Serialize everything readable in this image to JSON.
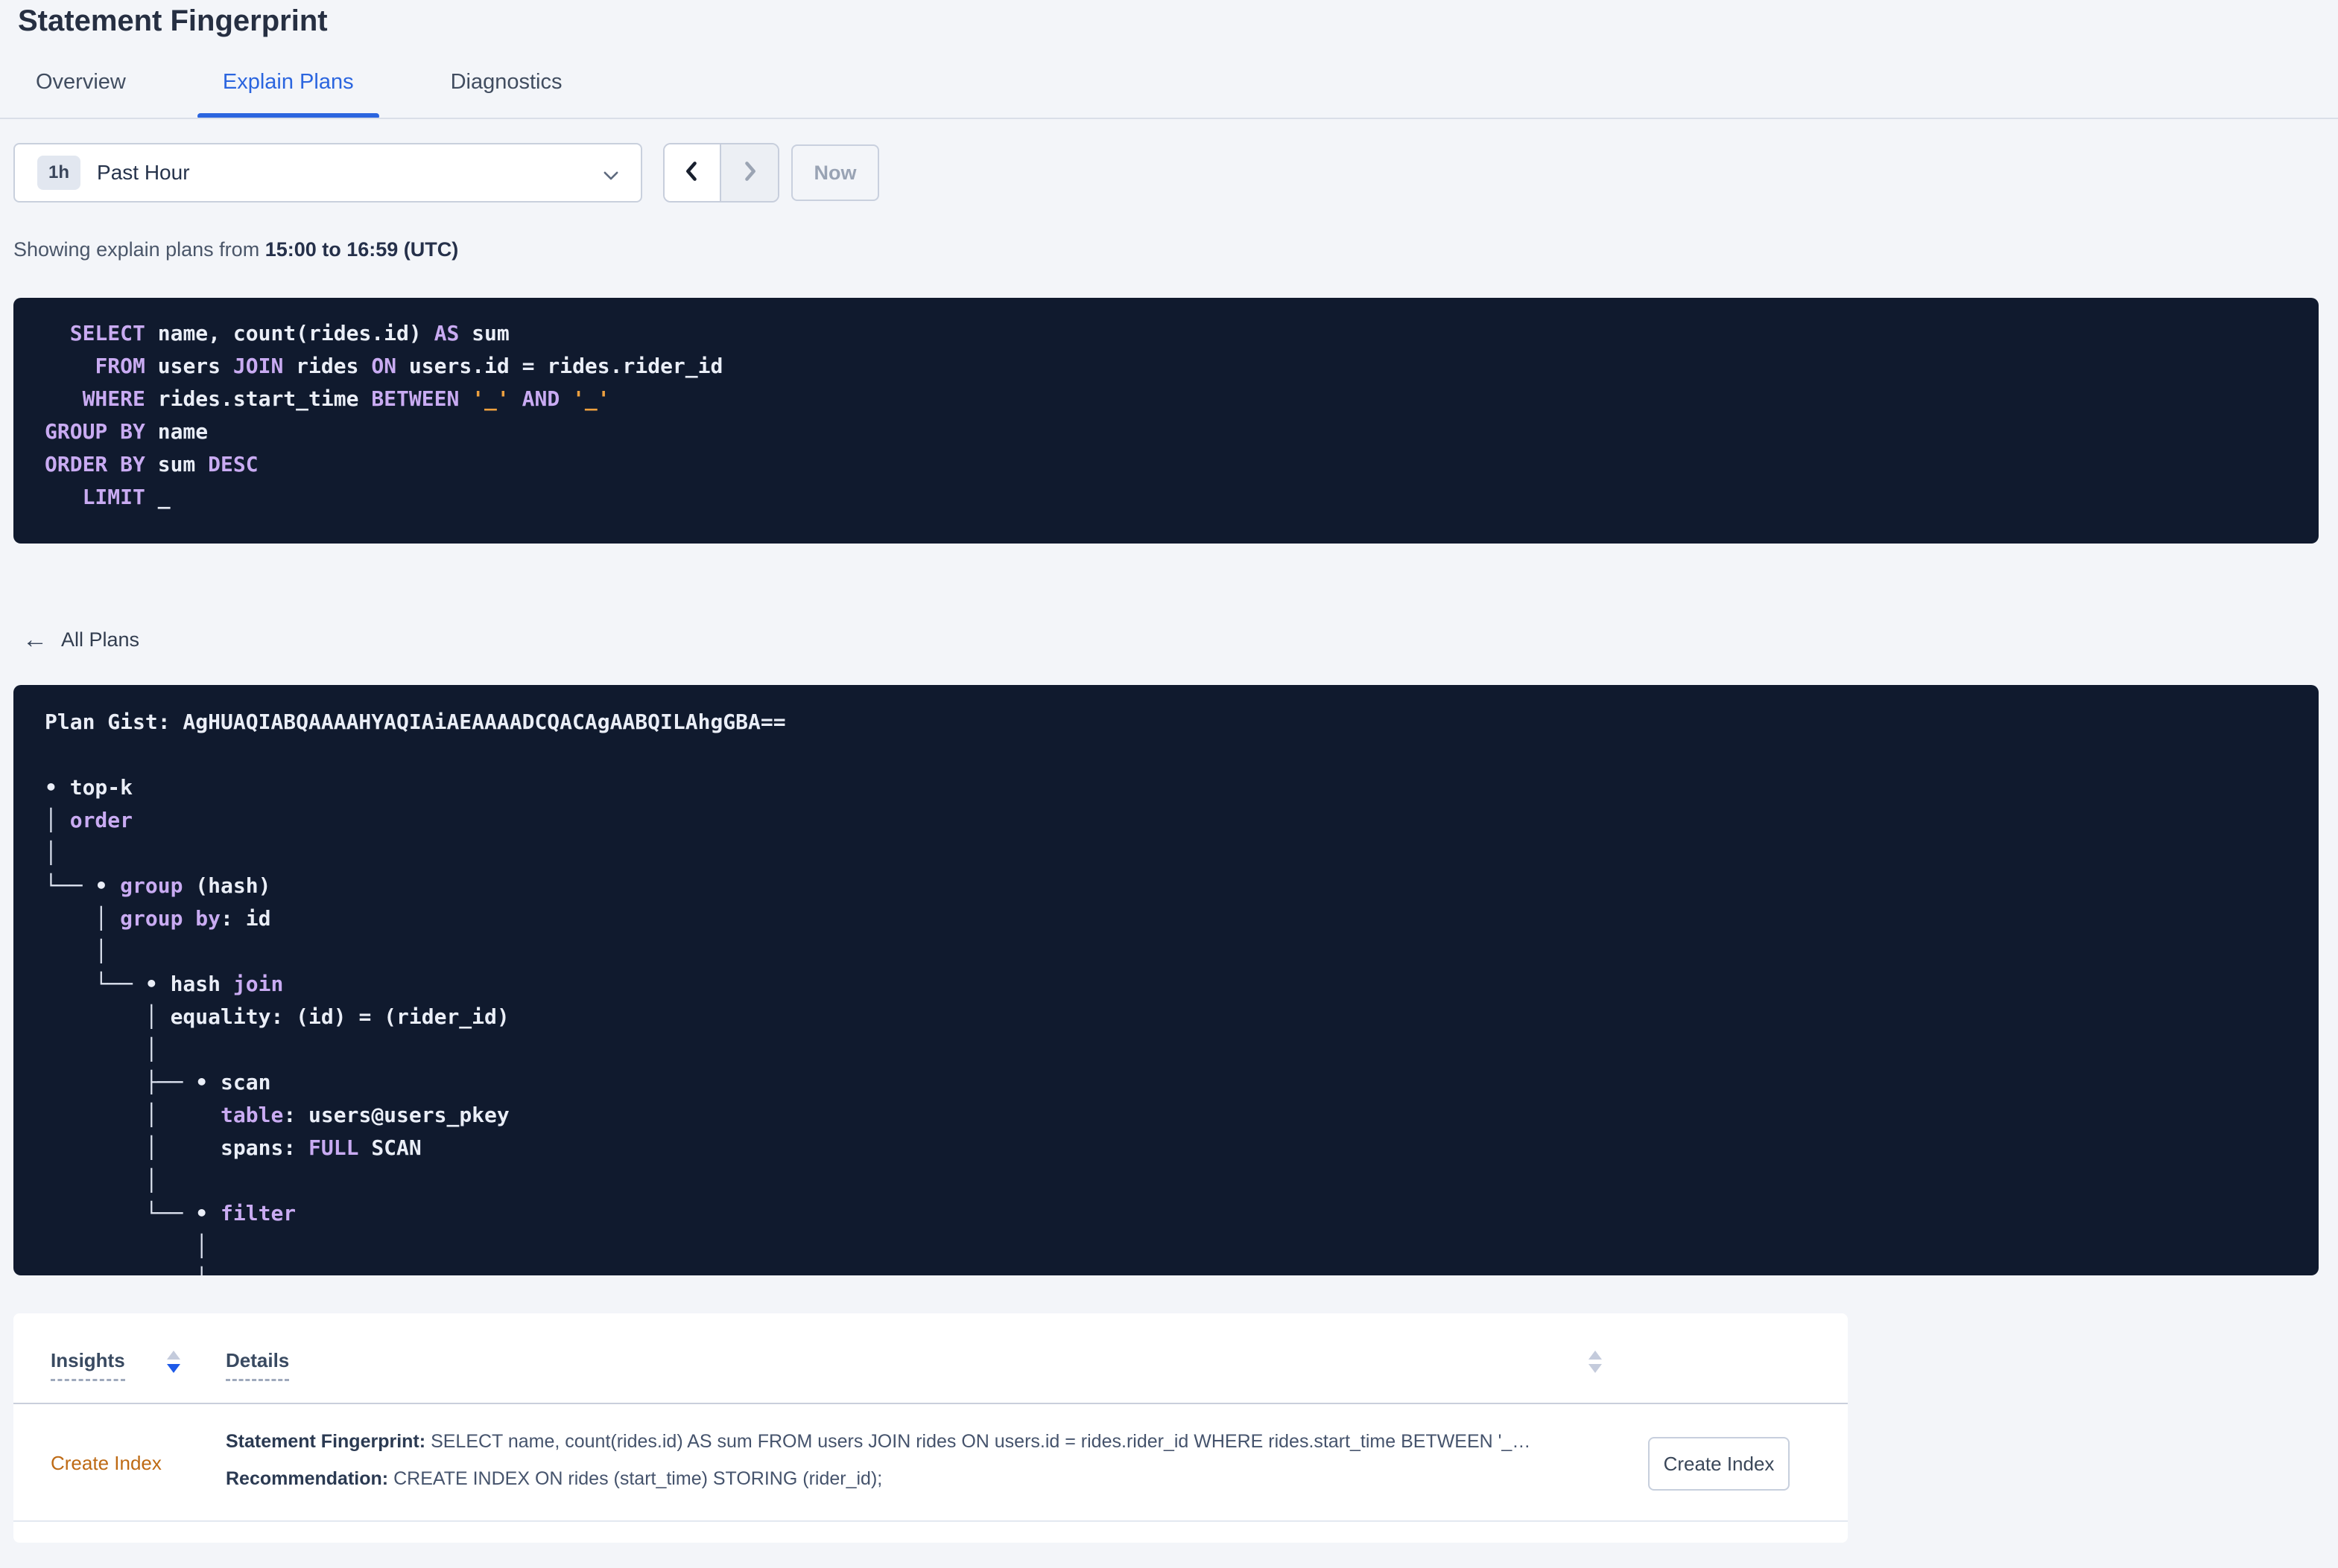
{
  "page_title": "Statement Fingerprint",
  "tabs": [
    {
      "label": "Overview",
      "active": false
    },
    {
      "label": "Explain Plans",
      "active": true
    },
    {
      "label": "Diagnostics",
      "active": false
    }
  ],
  "time_picker": {
    "badge": "1h",
    "selected": "Past Hour",
    "icon": "chevron-down"
  },
  "nav": {
    "back_icon": "chevron-left",
    "forward_icon": "chevron-right",
    "now_label": "Now"
  },
  "showing": {
    "prefix": "Showing explain plans from ",
    "range": "15:00 to 16:59 (UTC)"
  },
  "colors": {
    "accent_blue": "#2B65DF",
    "keyword_purple": "#C9ABF2",
    "placeholder_orange": "#EDA03F",
    "insight_orange": "#BE6A14",
    "code_background": "#101A2E"
  },
  "sql": {
    "lines": [
      [
        {
          "t": "  ",
          "c": "p"
        },
        {
          "t": "SELECT",
          "c": "k"
        },
        {
          "t": " name, count(rides.id) ",
          "c": "p"
        },
        {
          "t": "AS",
          "c": "k"
        },
        {
          "t": " sum",
          "c": "p"
        }
      ],
      [
        {
          "t": "    ",
          "c": "p"
        },
        {
          "t": "FROM",
          "c": "k"
        },
        {
          "t": " users ",
          "c": "p"
        },
        {
          "t": "JOIN",
          "c": "k"
        },
        {
          "t": " rides ",
          "c": "p"
        },
        {
          "t": "ON",
          "c": "k"
        },
        {
          "t": " users.id = rides.rider_id",
          "c": "p"
        }
      ],
      [
        {
          "t": "   ",
          "c": "p"
        },
        {
          "t": "WHERE",
          "c": "k"
        },
        {
          "t": " rides.start_time ",
          "c": "p"
        },
        {
          "t": "BETWEEN",
          "c": "k"
        },
        {
          "t": " ",
          "c": "p"
        },
        {
          "t": "'_'",
          "c": "o"
        },
        {
          "t": " ",
          "c": "p"
        },
        {
          "t": "AND",
          "c": "k"
        },
        {
          "t": " ",
          "c": "p"
        },
        {
          "t": "'_'",
          "c": "o"
        }
      ],
      [
        {
          "t": "GROUP BY",
          "c": "k"
        },
        {
          "t": " name",
          "c": "p"
        }
      ],
      [
        {
          "t": "ORDER BY",
          "c": "k"
        },
        {
          "t": " sum ",
          "c": "p"
        },
        {
          "t": "DESC",
          "c": "k"
        }
      ],
      [
        {
          "t": "   ",
          "c": "p"
        },
        {
          "t": "LIMIT",
          "c": "k"
        },
        {
          "t": " _",
          "c": "p"
        }
      ]
    ]
  },
  "all_plans": {
    "label": "All Plans",
    "icon": "arrow-left"
  },
  "plan": {
    "gist": "AgHUAQIABQAAAAHYAQIAiAEAAAADCQACAgAABQILAhgGBA==",
    "lines": [
      [
        {
          "t": "Plan Gist: AgHUAQIABQAAAAHYAQIAiAEAAAADCQACAgAABQILAhgGBA==",
          "c": "p"
        }
      ],
      [],
      [
        {
          "t": "• top-k",
          "c": "p"
        }
      ],
      [
        {
          "t": "│ ",
          "c": "t"
        },
        {
          "t": "order",
          "c": "k"
        }
      ],
      [
        {
          "t": "│",
          "c": "t"
        }
      ],
      [
        {
          "t": "└── ",
          "c": "t"
        },
        {
          "t": "• ",
          "c": "p"
        },
        {
          "t": "group",
          "c": "k"
        },
        {
          "t": " (hash)",
          "c": "p"
        }
      ],
      [
        {
          "t": "    │ ",
          "c": "t"
        },
        {
          "t": "group by",
          "c": "k"
        },
        {
          "t": ": id",
          "c": "p"
        }
      ],
      [
        {
          "t": "    │",
          "c": "t"
        }
      ],
      [
        {
          "t": "    └── ",
          "c": "t"
        },
        {
          "t": "• hash ",
          "c": "p"
        },
        {
          "t": "join",
          "c": "k"
        }
      ],
      [
        {
          "t": "        │ ",
          "c": "t"
        },
        {
          "t": "equality: (id) = (rider_id)",
          "c": "p"
        }
      ],
      [
        {
          "t": "        │",
          "c": "t"
        }
      ],
      [
        {
          "t": "        ├── ",
          "c": "t"
        },
        {
          "t": "• scan",
          "c": "p"
        }
      ],
      [
        {
          "t": "        │     ",
          "c": "t"
        },
        {
          "t": "table",
          "c": "k"
        },
        {
          "t": ": users@users_pkey",
          "c": "p"
        }
      ],
      [
        {
          "t": "        │     ",
          "c": "t"
        },
        {
          "t": "spans: ",
          "c": "p"
        },
        {
          "t": "FULL",
          "c": "k"
        },
        {
          "t": " SCAN",
          "c": "p"
        }
      ],
      [
        {
          "t": "        │",
          "c": "t"
        }
      ],
      [
        {
          "t": "        └── ",
          "c": "t"
        },
        {
          "t": "• ",
          "c": "p"
        },
        {
          "t": "filter",
          "c": "k"
        }
      ],
      [
        {
          "t": "            │",
          "c": "t"
        }
      ],
      [
        {
          "t": "            │",
          "c": "t"
        }
      ]
    ]
  },
  "insights_table": {
    "columns": [
      {
        "label": "Insights",
        "sort": "desc"
      },
      {
        "label": "Details",
        "sort": "none"
      }
    ],
    "rows": [
      {
        "insight": "Create Index",
        "statement_label": "Statement Fingerprint:",
        "statement": "SELECT name, count(rides.id) AS sum FROM users JOIN rides ON users.id = rides.rider_id WHERE rides.start_time BETWEEN '_…",
        "recommendation_label": "Recommendation:",
        "recommendation": "CREATE INDEX ON rides (start_time) STORING (rider_id);",
        "action_label": "Create Index"
      }
    ]
  }
}
